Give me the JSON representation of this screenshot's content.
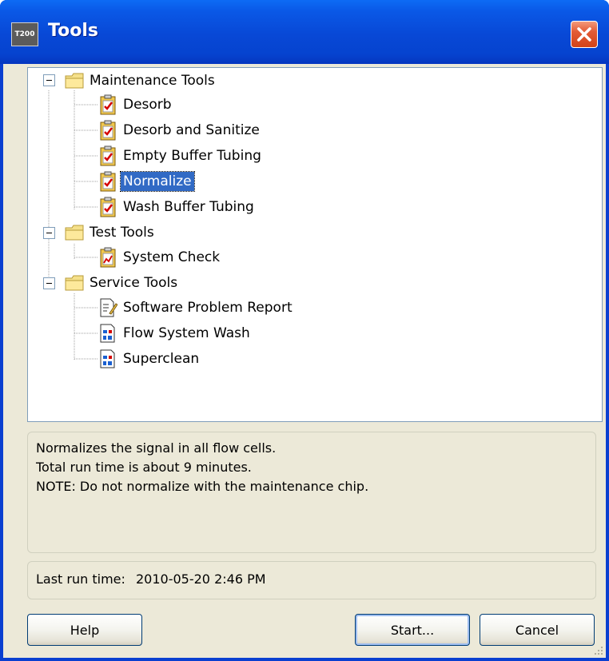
{
  "window": {
    "title": "Tools",
    "app_icon_text": "T200",
    "accent_color": "#0a58e6",
    "close_color": "#e35b35"
  },
  "tree": {
    "groups": [
      {
        "label": "Maintenance Tools",
        "icon": "folder-icon",
        "expanded": true,
        "items": [
          {
            "label": "Desorb",
            "icon": "clipboard-check-icon"
          },
          {
            "label": "Desorb and Sanitize",
            "icon": "clipboard-check-icon"
          },
          {
            "label": "Empty Buffer Tubing",
            "icon": "clipboard-check-icon"
          },
          {
            "label": "Normalize",
            "icon": "clipboard-check-icon",
            "selected": true
          },
          {
            "label": "Wash Buffer Tubing",
            "icon": "clipboard-check-icon"
          }
        ]
      },
      {
        "label": "Test Tools",
        "icon": "folder-icon",
        "expanded": true,
        "items": [
          {
            "label": "System Check",
            "icon": "clipboard-chart-icon"
          }
        ]
      },
      {
        "label": "Service Tools",
        "icon": "folder-icon",
        "expanded": true,
        "items": [
          {
            "label": "Software Problem Report",
            "icon": "document-edit-icon"
          },
          {
            "label": "Flow System Wash",
            "icon": "document-flowchart-icon"
          },
          {
            "label": "Superclean",
            "icon": "document-flowchart-icon"
          }
        ]
      }
    ]
  },
  "description": {
    "lines": [
      "Normalizes the signal in all flow cells.",
      "Total run time is about 9 minutes.",
      "NOTE: Do not normalize with the maintenance chip."
    ]
  },
  "last_run": {
    "label": "Last run time:",
    "value": "2010-05-20 2:46 PM"
  },
  "buttons": {
    "help": "Help",
    "start": "Start...",
    "cancel": "Cancel"
  }
}
